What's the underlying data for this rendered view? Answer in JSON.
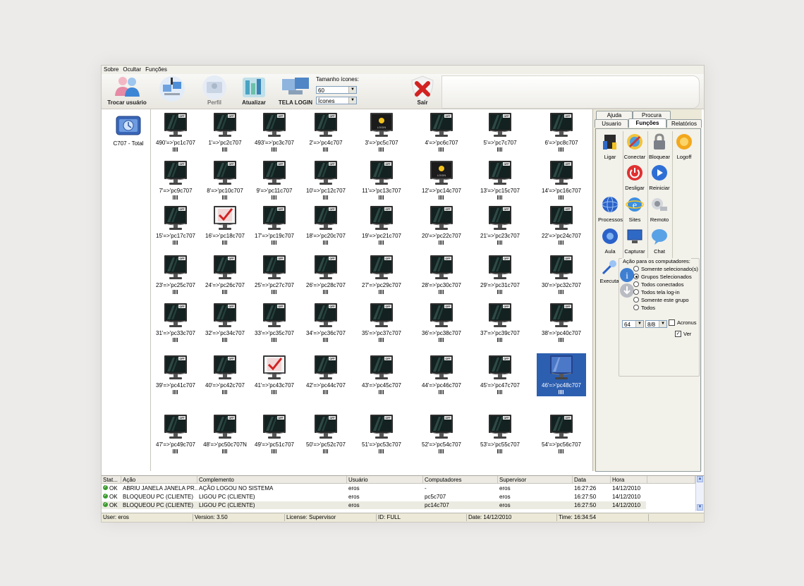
{
  "menu": [
    "Sobre",
    "Ocultar",
    "Funções"
  ],
  "toolbar": {
    "buttons": [
      {
        "label": "Trocar usuário",
        "enabled": true
      },
      {
        "label": "",
        "enabled": true
      },
      {
        "label": "Perfil",
        "enabled": false
      },
      {
        "label": "Atualizar",
        "enabled": true
      },
      {
        "label": "TELA LOGIN",
        "enabled": true
      },
      {
        "label": "Sair",
        "enabled": true
      }
    ],
    "icon_size_label": "Tamanho ícones:",
    "icon_size_value": "60",
    "view_value": "Ícones"
  },
  "group": {
    "label": "C707 - Total"
  },
  "computers": [
    {
      "label": "490'=>'pc1c707",
      "state": "off"
    },
    {
      "label": "1'=>'pc2c707",
      "state": "off"
    },
    {
      "label": "493'=>'pc3c707",
      "state": "off"
    },
    {
      "label": "2'=>'pc4c707",
      "state": "off"
    },
    {
      "label": "3'=>'pc5c707",
      "state": "login"
    },
    {
      "label": "4'=>'pc6c707",
      "state": "off"
    },
    {
      "label": "5'=>'pc7c707",
      "state": "off"
    },
    {
      "label": "6'=>'pc8c707",
      "state": "off"
    },
    {
      "label": "7'=>'pc9c707",
      "state": "off"
    },
    {
      "label": "8'=>'pc10c707",
      "state": "off"
    },
    {
      "label": "9'=>'pc11c707",
      "state": "off"
    },
    {
      "label": "10'=>'pc12c707",
      "state": "off"
    },
    {
      "label": "11'=>'pc13c707",
      "state": "off"
    },
    {
      "label": "12'=>'pc14c707",
      "state": "login"
    },
    {
      "label": "13'=>'pc15c707",
      "state": "off"
    },
    {
      "label": "14'=>'pc16c707",
      "state": "off"
    },
    {
      "label": "15'=>'pc17c707",
      "state": "off"
    },
    {
      "label": "16'=>'pc18c707",
      "state": "checked"
    },
    {
      "label": "17'=>'pc19c707",
      "state": "off"
    },
    {
      "label": "18'=>'pc20c707",
      "state": "off"
    },
    {
      "label": "19'=>'pc21c707",
      "state": "off"
    },
    {
      "label": "20'=>'pc22c707",
      "state": "off"
    },
    {
      "label": "21'=>'pc23c707",
      "state": "off"
    },
    {
      "label": "22'=>'pc24c707",
      "state": "off"
    },
    {
      "label": "23'=>'pc25c707",
      "state": "off"
    },
    {
      "label": "24'=>'pc26c707",
      "state": "off"
    },
    {
      "label": "25'=>'pc27c707",
      "state": "off"
    },
    {
      "label": "26'=>'pc28c707",
      "state": "off"
    },
    {
      "label": "27'=>'pc29c707",
      "state": "off"
    },
    {
      "label": "28'=>'pc30c707",
      "state": "off"
    },
    {
      "label": "29'=>'pc31c707",
      "state": "off"
    },
    {
      "label": "30'=>'pc32c707",
      "state": "off"
    },
    {
      "label": "31'=>'pc33c707",
      "state": "off"
    },
    {
      "label": "32'=>'pc34c707",
      "state": "off"
    },
    {
      "label": "33'=>'pc35c707",
      "state": "off"
    },
    {
      "label": "34'=>'pc36c707",
      "state": "off"
    },
    {
      "label": "35'=>'pc37c707",
      "state": "off"
    },
    {
      "label": "36'=>'pc38c707",
      "state": "off"
    },
    {
      "label": "37'=>'pc39c707",
      "state": "off"
    },
    {
      "label": "38'=>'pc40c707",
      "state": "off"
    },
    {
      "label": "39'=>'pc41c707",
      "state": "off"
    },
    {
      "label": "40'=>'pc42c707",
      "state": "off"
    },
    {
      "label": "41'=>'pc43c707",
      "state": "checked"
    },
    {
      "label": "42'=>'pc44c707",
      "state": "off"
    },
    {
      "label": "43'=>'pc45c707",
      "state": "off"
    },
    {
      "label": "44'=>'pc46c707",
      "state": "off"
    },
    {
      "label": "45'=>'pc47c707",
      "state": "off"
    },
    {
      "label": "46'=>'pc48c707",
      "state": "selected"
    },
    {
      "label": "47'=>'pc49c707",
      "state": "off"
    },
    {
      "label": "48'=>'pc50c707N",
      "state": "off"
    },
    {
      "label": "49'=>'pc51c707",
      "state": "off"
    },
    {
      "label": "50'=>'pc52c707",
      "state": "off"
    },
    {
      "label": "51'=>'pc53c707",
      "state": "off"
    },
    {
      "label": "52'=>'pc54c707",
      "state": "off"
    },
    {
      "label": "53'=>'pc55c707",
      "state": "off"
    },
    {
      "label": "54'=>'pc56c707",
      "state": "off"
    }
  ],
  "screen_text": {
    "off": "OFF",
    "login": "LOGIN"
  },
  "tabs_top": [
    "Ajuda",
    "Procura"
  ],
  "tabs_bottom": [
    "Usuario",
    "Funções",
    "Relatórios"
  ],
  "functions": [
    {
      "label": "Ligar",
      "icon": "power-on-icon"
    },
    {
      "label": "Conectar",
      "icon": "connect-icon"
    },
    {
      "label": "Bloquear",
      "icon": "lock-icon"
    },
    {
      "label": "Logoff",
      "icon": "logoff-icon"
    },
    {
      "label": "Desligar",
      "icon": "shutdown-icon"
    },
    {
      "label": "Reiniciar",
      "icon": "restart-icon"
    },
    {
      "label": "Processos",
      "icon": "processes-icon"
    },
    {
      "label": "Sites",
      "icon": "sites-icon"
    },
    {
      "label": "Remoto",
      "icon": "remote-icon"
    },
    {
      "label": "Aula",
      "icon": "class-icon"
    },
    {
      "label": "Capturar",
      "icon": "capture-icon"
    },
    {
      "label": "Chat",
      "icon": "chat-icon"
    }
  ],
  "action": {
    "execute_label": "Executa",
    "group_title": "Ação para os computadores:",
    "options": [
      "Somente selecionado(s)",
      "Grupos Selecionados",
      "Todos conectados",
      "Todos tela log-in",
      "Somente este grupo",
      "Todos"
    ],
    "selected_option": 1,
    "depth_value": "64",
    "ratio_value": "8/8",
    "acronus_label": "Acronus",
    "acronus_checked": false,
    "ver_label": "Ver",
    "ver_checked": true
  },
  "log": {
    "columns": [
      "Stat...",
      "Ação",
      "Complemento",
      "Usuário",
      "Computadores",
      "Supervisor",
      "Data",
      "Hora"
    ],
    "rows": [
      [
        "OK",
        "ABRIU JANELA JANELA PR...",
        "AÇÃO LOGOU NO SISTEMA",
        "eros",
        "-",
        "eros",
        "16:27:26",
        "14/12/2010"
      ],
      [
        "OK",
        "BLOQUEOU PC (CLIENTE)",
        "LIGOU PC (CLIENTE)",
        "eros",
        "pc5c707",
        "eros",
        "16:27:50",
        "14/12/2010"
      ],
      [
        "OK",
        "BLOQUEOU PC (CLIENTE)",
        "LIGOU PC (CLIENTE)",
        "eros",
        "pc14c707",
        "eros",
        "16:27:50",
        "14/12/2010"
      ]
    ]
  },
  "status": {
    "user": "User: eros",
    "version": "Version: 3.50",
    "license": "License: Supervisor",
    "id": "ID: FULL",
    "date": "Date: 14/12/2010",
    "time": "Time: 16:34:54"
  },
  "colors": {
    "selection": "#2d5fb0",
    "panel": "#ece9d8",
    "ok": "#3b9c2f",
    "danger": "#d22222"
  }
}
